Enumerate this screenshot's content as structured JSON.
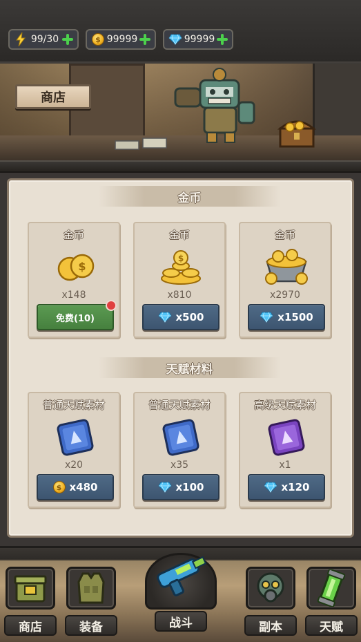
{
  "resources": [
    {
      "icon": "energy-bolt-icon",
      "value": "99/30"
    },
    {
      "icon": "gold-coin-icon",
      "value": "99999"
    },
    {
      "icon": "diamond-icon",
      "value": "99999"
    }
  ],
  "coin_symbol": "$",
  "banner": {
    "title": "商店"
  },
  "sections": {
    "gold": {
      "title": "金币"
    },
    "talent": {
      "title": "天赋材料"
    }
  },
  "gold_items": [
    {
      "name": "金币",
      "qty": "x148",
      "price": "免费(10)",
      "currency": "free",
      "badge": true
    },
    {
      "name": "金币",
      "qty": "x810",
      "price": "x500",
      "currency": "diamond"
    },
    {
      "name": "金币",
      "qty": "x2970",
      "price": "x1500",
      "currency": "diamond"
    }
  ],
  "talent_items": [
    {
      "name": "普通天赋素材",
      "qty": "x20",
      "price": "x480",
      "currency": "coin",
      "tier": "common"
    },
    {
      "name": "普通天赋素材",
      "qty": "x35",
      "price": "x100",
      "currency": "diamond",
      "tier": "common"
    },
    {
      "name": "高级天赋素材",
      "qty": "x1",
      "price": "x120",
      "currency": "diamond",
      "tier": "advanced"
    }
  ],
  "nav": {
    "shop": "商店",
    "equip": "装备",
    "battle": "战斗",
    "dungeon": "副本",
    "talent": "天赋"
  },
  "colors": {
    "diamond_button": "#46607c",
    "free_button": "#52904a",
    "panel": "#e8e0d3",
    "plus_green": "#4cd04c",
    "badge_red": "#e04040"
  }
}
